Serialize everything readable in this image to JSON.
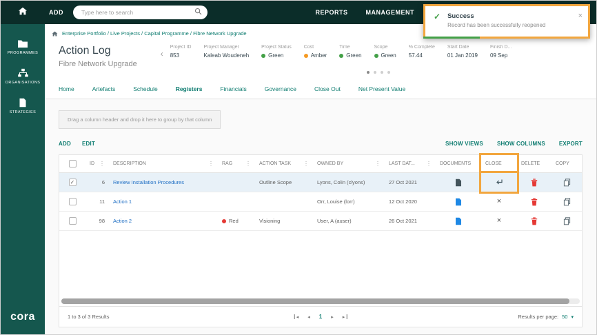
{
  "topbar": {
    "add_label": "ADD",
    "search_placeholder": "Type here to search",
    "reports_label": "REPORTS",
    "management_label": "MANAGEMENT"
  },
  "toast": {
    "title": "Success",
    "message": "Record has been successfully reopened",
    "close_label": "×"
  },
  "sidebar": {
    "items": [
      {
        "id": "programmes",
        "icon": "folder",
        "label": "PROGRAMMES"
      },
      {
        "id": "organisations",
        "icon": "sitemap",
        "label": "ORGANISATIONS"
      },
      {
        "id": "strategies",
        "icon": "doc",
        "label": "STRATEGIES"
      }
    ],
    "logo": "cora"
  },
  "breadcrumb": "Enterprise Portfolio / Live Projects / Capital Programme / Fibre Network Upgrade",
  "page": {
    "title": "Action Log",
    "subtitle": "Fibre Network Upgrade"
  },
  "project_info": {
    "fields": [
      {
        "label": "Project ID",
        "value": "853"
      },
      {
        "label": "Project Manager",
        "value": "Kaleab Woudeneh"
      },
      {
        "label": "Project Status",
        "value": "Green",
        "dot": "#43a047"
      },
      {
        "label": "Cost",
        "value": "Amber",
        "dot": "#f59a23"
      },
      {
        "label": "Time",
        "value": "Green",
        "dot": "#43a047"
      },
      {
        "label": "Scope",
        "value": "Green",
        "dot": "#43a047"
      },
      {
        "label": "% Complete",
        "value": "57.44"
      },
      {
        "label": "Start Date",
        "value": "01 Jan 2019"
      },
      {
        "label": "Finish D...",
        "value": "09 Sep"
      }
    ],
    "pager_dots": 4,
    "active_dot": 0
  },
  "tabs": {
    "items": [
      "Home",
      "Artefacts",
      "Schedule",
      "Registers",
      "Financials",
      "Governance",
      "Close Out",
      "Net Present Value"
    ],
    "active": "Registers"
  },
  "group_bar": "Drag a column header and drop it here to group by that column",
  "toolbar": {
    "add": "ADD",
    "edit": "EDIT",
    "show_views": "SHOW VIEWS",
    "show_columns": "SHOW COLUMNS",
    "export": "EXPORT"
  },
  "table": {
    "columns": [
      {
        "key": "id",
        "label": "ID",
        "menu": true
      },
      {
        "key": "description",
        "label": "DESCRIPTION",
        "menu": true
      },
      {
        "key": "rag",
        "label": "RAG",
        "menu": true
      },
      {
        "key": "action-task",
        "label": "ACTION TASK",
        "menu": true
      },
      {
        "key": "owned-by",
        "label": "OWNED BY",
        "menu": true
      },
      {
        "key": "last-date",
        "label": "LAST DAT...",
        "menu": true
      },
      {
        "key": "documents",
        "label": "DOCUMENTS",
        "menu": false
      },
      {
        "key": "close",
        "label": "CLOSE",
        "menu": false,
        "highlight": true
      },
      {
        "key": "delete",
        "label": "DELETE",
        "menu": false
      },
      {
        "key": "copy",
        "label": "COPY",
        "menu": false
      }
    ],
    "rows": [
      {
        "checked": true,
        "selected": true,
        "id": "6",
        "description": "Review Installation Procedures",
        "rag": null,
        "task": "Outline Scope",
        "owned_by": "Lyons, Colin (clyons)",
        "last_date": "27 Oct 2021",
        "doc_color": "dark",
        "close": "reopen",
        "close_highlight": true
      },
      {
        "checked": false,
        "selected": false,
        "id": "11",
        "description": "Action 1",
        "rag": null,
        "task": "",
        "owned_by": "Orr, Louise (lorr)",
        "last_date": "12 Oct 2020",
        "doc_color": "blue",
        "close": "close",
        "close_highlight": false
      },
      {
        "checked": false,
        "selected": false,
        "id": "98",
        "description": "Action 2",
        "rag": {
          "color": "#e53935",
          "label": "Red"
        },
        "task": "Visioning",
        "owned_by": "User, A (auser)",
        "last_date": "26 Oct 2021",
        "doc_color": "blue",
        "close": "close",
        "close_highlight": false
      }
    ]
  },
  "footer": {
    "results": "1 to 3 of 3 Results",
    "current_page": "1",
    "per_page_label": "Results per page:",
    "per_page_value": "50"
  },
  "colors": {
    "accent_teal": "#0e7c70",
    "link_blue": "#1f6fc4",
    "highlight_orange": "#f2a63e",
    "success_green": "#43a047",
    "danger_red": "#e53935"
  }
}
